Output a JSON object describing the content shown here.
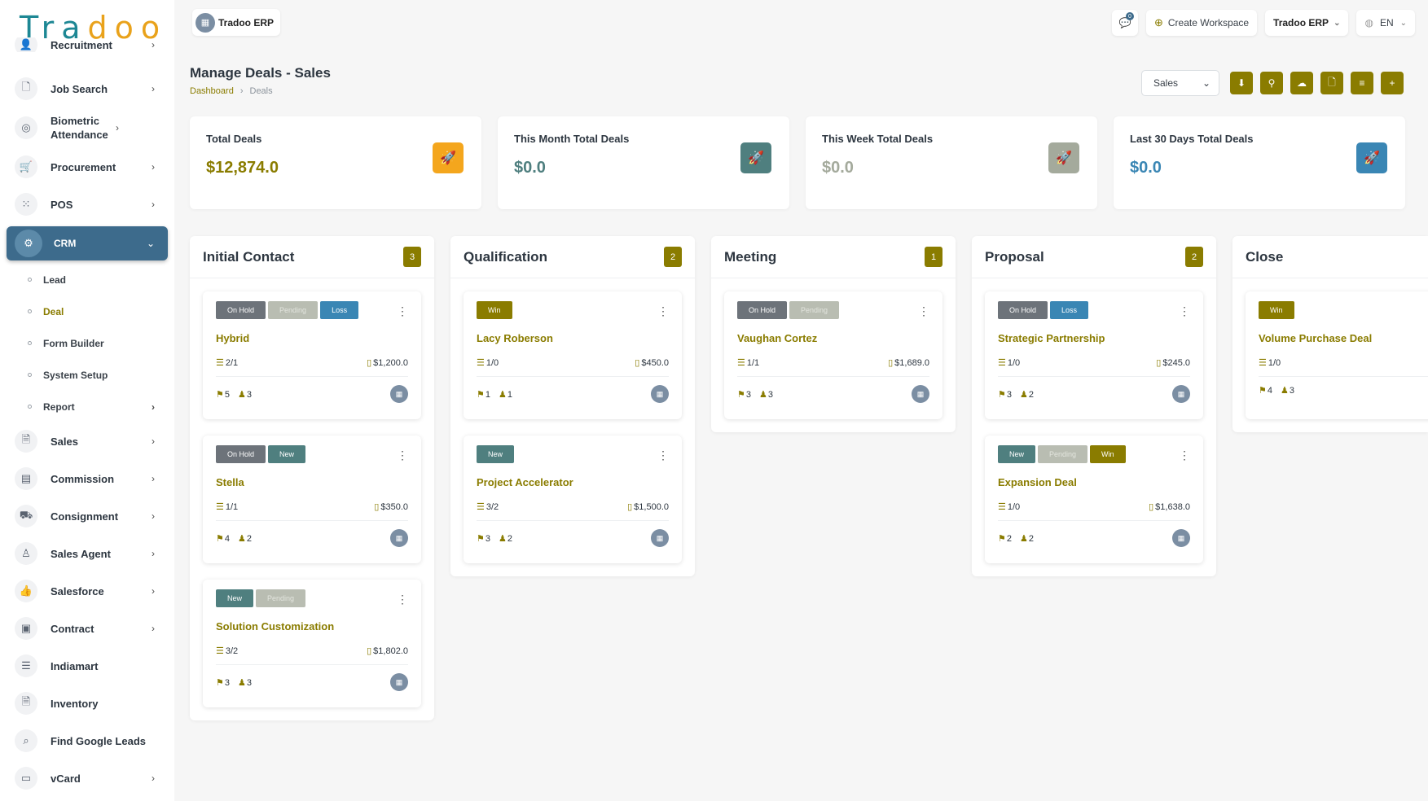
{
  "brand": {
    "logo_text": "Tradoo",
    "workspace": "Tradoo ERP"
  },
  "topbar": {
    "notifications": "0",
    "create_workspace": "Create Workspace",
    "workspace_selector": "Tradoo ERP",
    "language": "EN"
  },
  "sidebar": {
    "items": [
      {
        "label": "Recruitment",
        "icon": "user-icon"
      },
      {
        "label": "Job Search",
        "icon": "file-search-icon"
      },
      {
        "label": "Biometric Attendance",
        "icon": "fingerprint-icon"
      },
      {
        "label": "Procurement",
        "icon": "cart-icon"
      },
      {
        "label": "POS",
        "icon": "grid-icon"
      },
      {
        "label": "CRM",
        "icon": "crm-icon"
      }
    ],
    "crm_sub": [
      {
        "label": "Lead"
      },
      {
        "label": "Deal"
      },
      {
        "label": "Form Builder"
      },
      {
        "label": "System Setup"
      },
      {
        "label": "Report"
      }
    ],
    "more": [
      {
        "label": "Sales"
      },
      {
        "label": "Commission"
      },
      {
        "label": "Consignment"
      },
      {
        "label": "Sales Agent"
      },
      {
        "label": "Salesforce"
      },
      {
        "label": "Contract"
      },
      {
        "label": "Indiamart"
      },
      {
        "label": "Inventory"
      },
      {
        "label": "Find Google Leads"
      },
      {
        "label": "vCard"
      }
    ]
  },
  "page": {
    "title": "Manage Deals - Sales",
    "breadcrumb": [
      "Dashboard",
      "Deals"
    ],
    "pipeline_select": "Sales"
  },
  "stats": [
    {
      "label": "Total Deals",
      "value": "$12,874.0",
      "color": "#8a7c00",
      "icon_bg": "#f4a61d"
    },
    {
      "label": "This Month Total Deals",
      "value": "$0.0",
      "color": "#4f7f7f",
      "icon_bg": "#4f7f7f"
    },
    {
      "label": "This Week Total Deals",
      "value": "$0.0",
      "color": "#a4aa9c",
      "icon_bg": "#a4aa9c"
    },
    {
      "label": "Last 30 Days Total Deals",
      "value": "$0.0",
      "color": "#3a86b4",
      "icon_bg": "#3a86b4"
    }
  ],
  "stages": [
    {
      "title": "Initial Contact",
      "count": "3",
      "cards": [
        {
          "tags": [
            "On Hold",
            "Pending",
            "Loss"
          ],
          "name": "Hybrid",
          "tasks": "2/1",
          "price": "$1,200.0",
          "sources": "5",
          "users": "3"
        },
        {
          "tags": [
            "On Hold",
            "New"
          ],
          "name": "Stella",
          "tasks": "1/1",
          "price": "$350.0",
          "sources": "4",
          "users": "2"
        },
        {
          "tags": [
            "New",
            "Pending"
          ],
          "name": "Solution Customization",
          "tasks": "3/2",
          "price": "$1,802.0",
          "sources": "3",
          "users": "3"
        }
      ]
    },
    {
      "title": "Qualification",
      "count": "2",
      "cards": [
        {
          "tags": [
            "Win"
          ],
          "name": "Lacy Roberson",
          "tasks": "1/0",
          "price": "$450.0",
          "sources": "1",
          "users": "1"
        },
        {
          "tags": [
            "New"
          ],
          "name": "Project Accelerator",
          "tasks": "3/2",
          "price": "$1,500.0",
          "sources": "3",
          "users": "2"
        }
      ]
    },
    {
      "title": "Meeting",
      "count": "1",
      "cards": [
        {
          "tags": [
            "On Hold",
            "Pending"
          ],
          "name": "Vaughan Cortez",
          "tasks": "1/1",
          "price": "$1,689.0",
          "sources": "3",
          "users": "3"
        }
      ]
    },
    {
      "title": "Proposal",
      "count": "2",
      "cards": [
        {
          "tags": [
            "On Hold",
            "Loss"
          ],
          "name": "Strategic Partnership",
          "tasks": "1/0",
          "price": "$245.0",
          "sources": "3",
          "users": "2"
        },
        {
          "tags": [
            "New",
            "Pending",
            "Win"
          ],
          "name": "Expansion Deal",
          "tasks": "1/0",
          "price": "$1,638.0",
          "sources": "2",
          "users": "2"
        }
      ]
    },
    {
      "title": "Close",
      "count": "",
      "cards": [
        {
          "tags": [
            "Win"
          ],
          "name": "Volume Purchase Deal",
          "tasks": "1/0",
          "price": "",
          "sources": "4",
          "users": "3"
        }
      ]
    }
  ]
}
